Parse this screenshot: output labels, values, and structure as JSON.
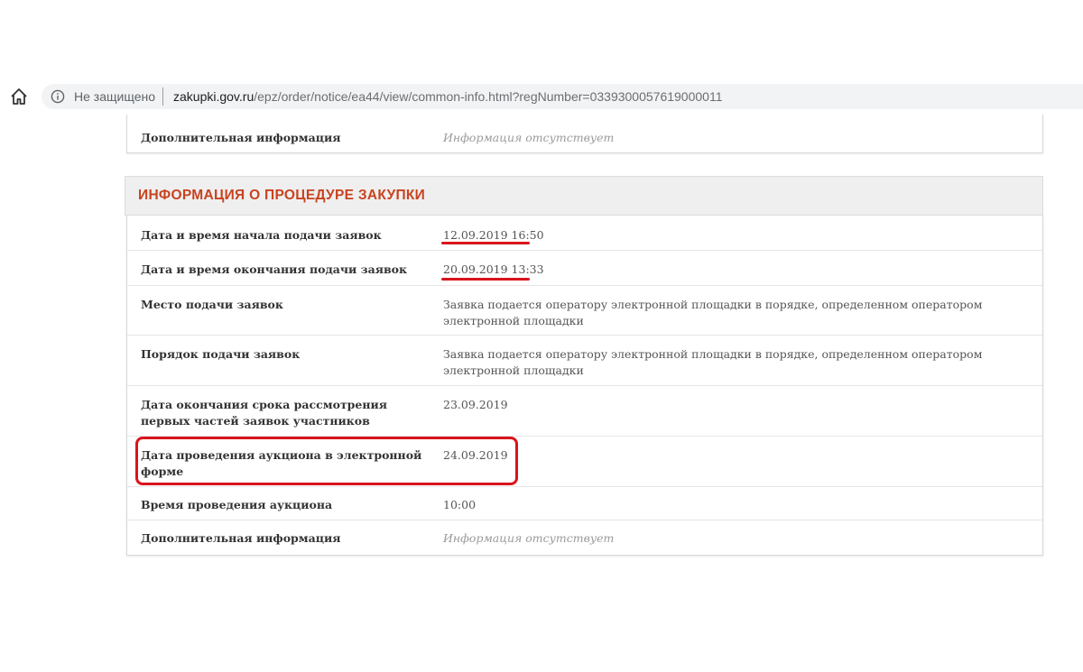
{
  "browser": {
    "security": "Не защищено",
    "domain": "zakupki.gov.ru",
    "path": "/epz/order/notice/ea44/view/common-info.html?regNumber=0339300057619000011"
  },
  "top_card": {
    "label": "Дополнительная информация",
    "value": "Информация отсутствует"
  },
  "procedure": {
    "title": "ИНФОРМАЦИЯ О ПРОЦЕДУРЕ ЗАКУПКИ",
    "rows": [
      {
        "label": "Дата и время начала подачи заявок",
        "value": "12.09.2019 16:50"
      },
      {
        "label": "Дата и время окончания подачи заявок",
        "value": "20.09.2019 13:33"
      },
      {
        "label": "Место подачи заявок",
        "value": "Заявка подается оператору электронной площадки в порядке, определенном оператором электронной площадки"
      },
      {
        "label": "Порядок подачи заявок",
        "value": "Заявка подается оператору электронной площадки в порядке, определенном оператором электронной площадки"
      },
      {
        "label": "Дата окончания срока рассмотрения первых частей заявок участников",
        "value": "23.09.2019"
      },
      {
        "label": "Дата проведения аукциона в электронной форме",
        "value": "24.09.2019"
      },
      {
        "label": "Время проведения аукциона",
        "value": "10:00"
      },
      {
        "label": "Дополнительная информация",
        "value": "Информация отсутствует"
      }
    ]
  },
  "annotation_color": "#d9141b",
  "accent_color": "#c8431f"
}
